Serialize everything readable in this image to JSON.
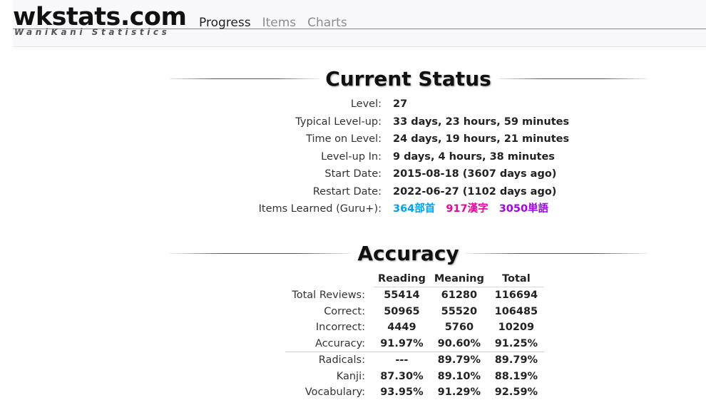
{
  "header": {
    "brand": "wkstats.com",
    "subtitle": "WaniKani Statistics",
    "nav": [
      {
        "label": "Progress",
        "active": true
      },
      {
        "label": "Items",
        "active": false
      },
      {
        "label": "Charts",
        "active": false
      }
    ]
  },
  "colors": {
    "radical": "#00a1f1",
    "kanji": "#f100a1",
    "vocabulary": "#a100f1"
  },
  "status": {
    "title": "Current Status",
    "level_label": "Level:",
    "level": "27",
    "typical_label": "Typical Level-up:",
    "typical": "33 days, 23 hours, 59 minutes",
    "time_on_level_label": "Time on Level:",
    "time_on_level": "24 days, 19 hours, 21 minutes",
    "levelup_in_label": "Level-up In:",
    "levelup_in": "9 days, 4 hours, 38 minutes",
    "start_label": "Start Date:",
    "start": "2015-08-18 (3607 days ago)",
    "restart_label": "Restart Date:",
    "restart": "2022-06-27 (1102 days ago)",
    "learned_label": "Items Learned (Guru+):",
    "learned_radicals": "364部首",
    "learned_kanji": "917漢字",
    "learned_vocab": "3050単語"
  },
  "accuracy": {
    "title": "Accuracy",
    "headers": [
      "Reading",
      "Meaning",
      "Total"
    ],
    "rows": [
      {
        "label": "Total Reviews:",
        "reading": "55414",
        "meaning": "61280",
        "total": "116694"
      },
      {
        "label": "Correct:",
        "reading": "50965",
        "meaning": "55520",
        "total": "106485"
      },
      {
        "label": "Incorrect:",
        "reading": "4449",
        "meaning": "5760",
        "total": "10209"
      },
      {
        "label": "Accuracy:",
        "reading": "91.97%",
        "meaning": "90.60%",
        "total": "91.25%"
      },
      {
        "label": "Radicals:",
        "reading": "---",
        "meaning": "89.79%",
        "total": "89.79%"
      },
      {
        "label": "Kanji:",
        "reading": "87.30%",
        "meaning": "89.10%",
        "total": "88.19%"
      },
      {
        "label": "Vocabulary:",
        "reading": "93.95%",
        "meaning": "91.29%",
        "total": "92.59%"
      }
    ]
  }
}
